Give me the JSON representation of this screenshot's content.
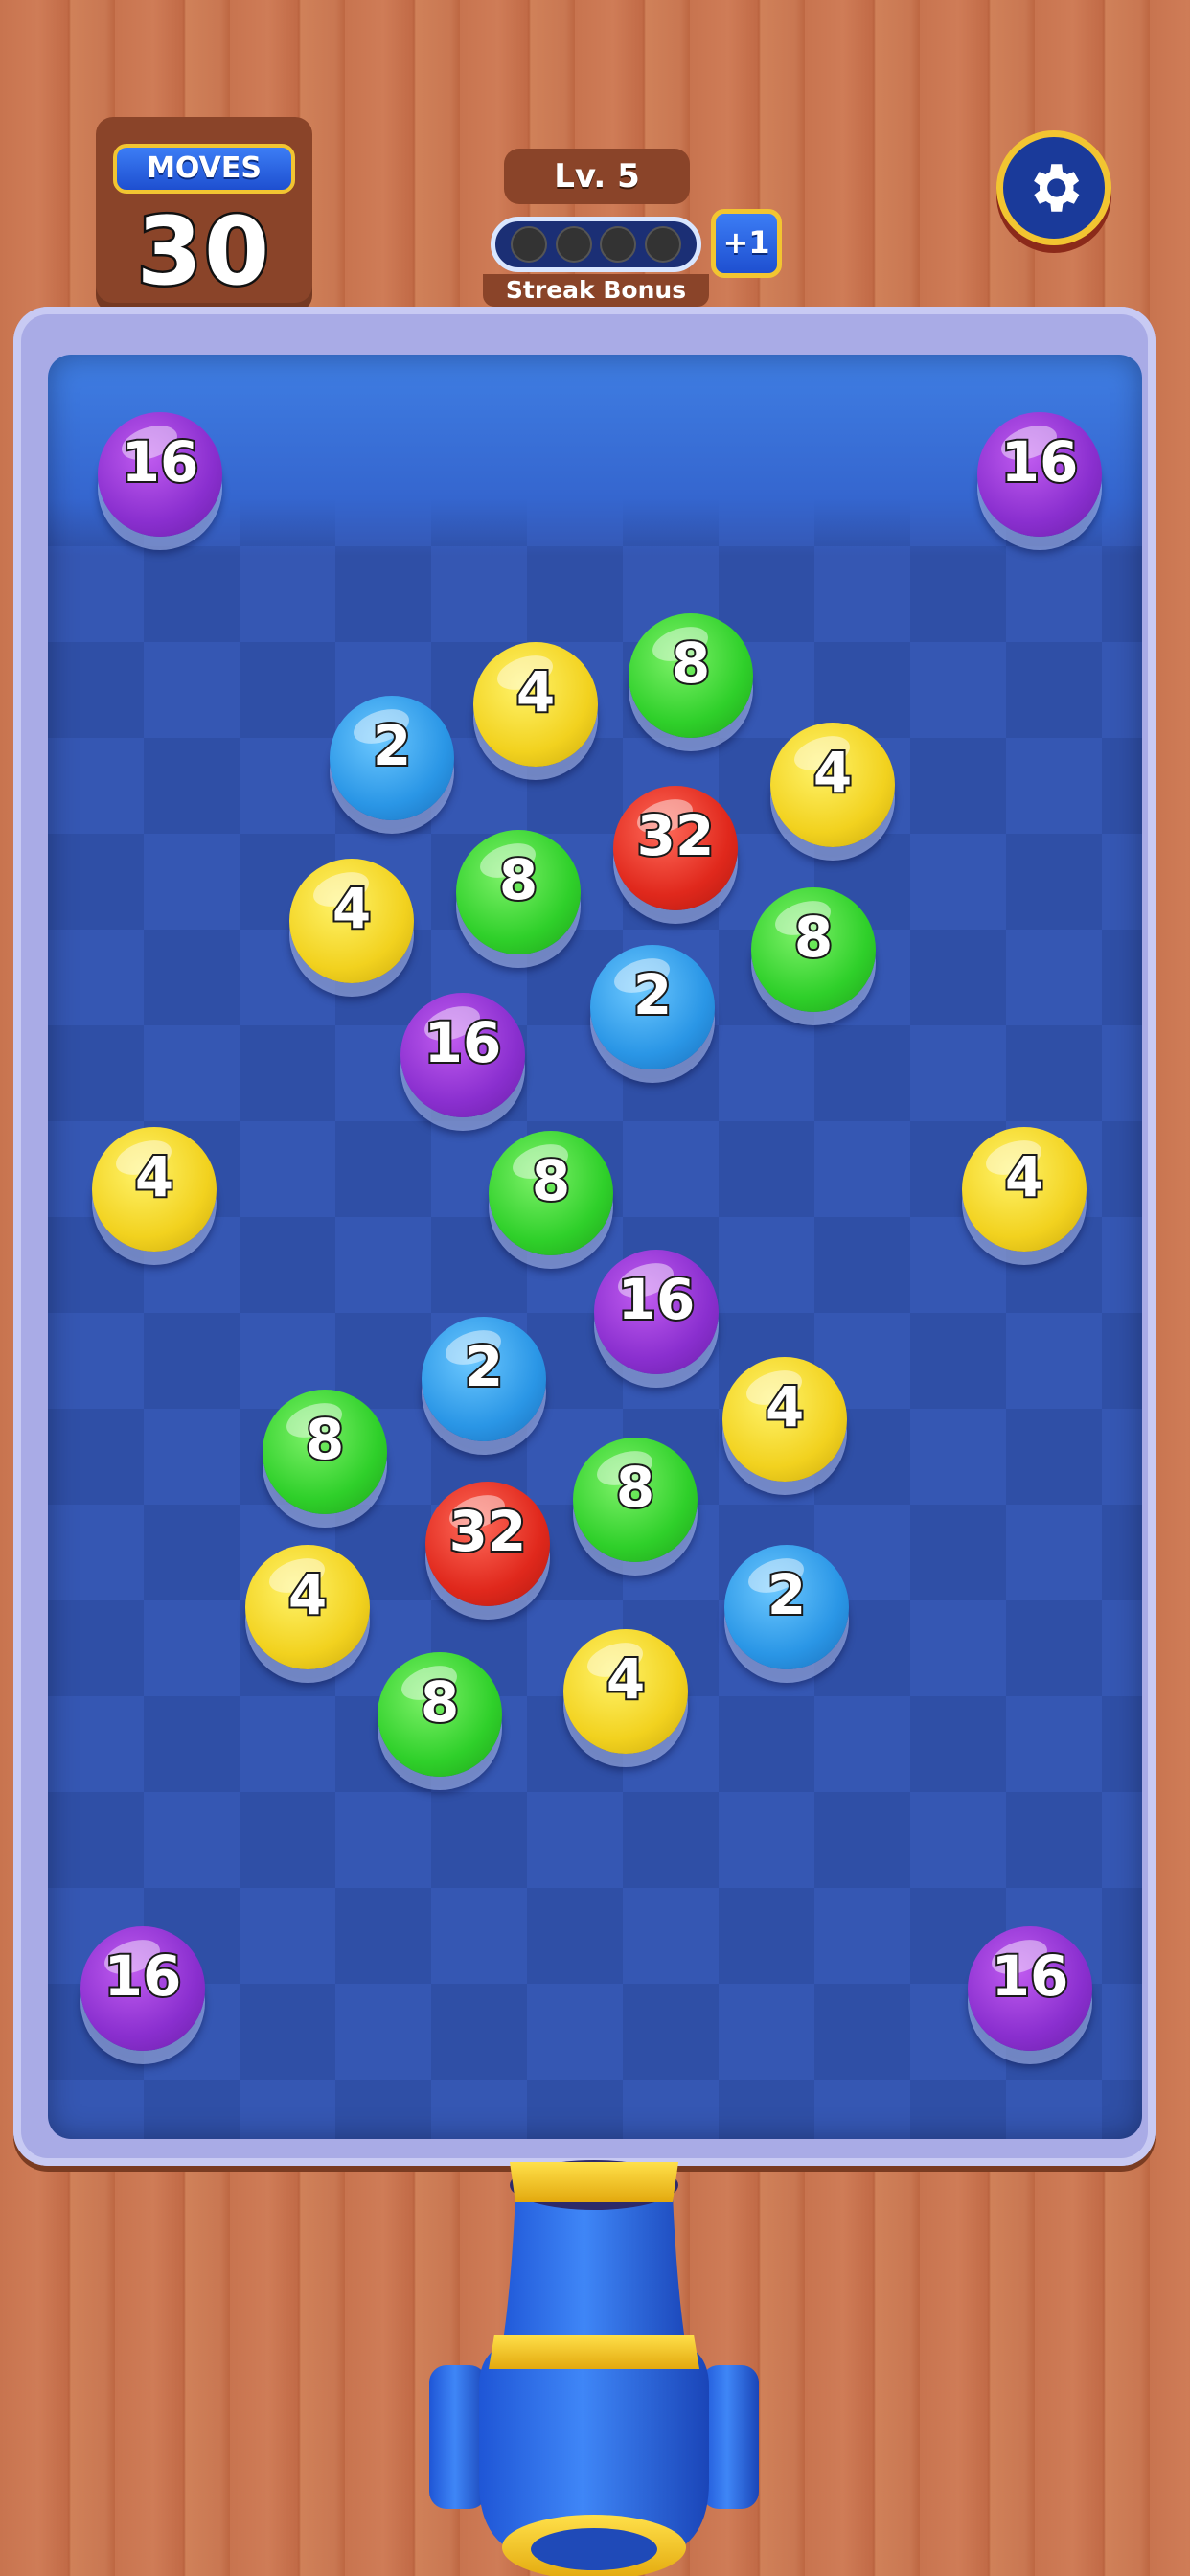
{
  "hud": {
    "moves_label": "MOVES",
    "moves_value": "30",
    "level_label": "Lv. 5",
    "streak_label": "Streak Bonus",
    "streak_bonus": "+1",
    "streak_filled": 0,
    "streak_total": 4
  },
  "icons": {
    "settings": "gear-icon"
  },
  "board": {
    "balls": [
      {
        "value": "16",
        "color": "purple"
      },
      {
        "value": "16",
        "color": "purple"
      },
      {
        "value": "8",
        "color": "green"
      },
      {
        "value": "4",
        "color": "yellow"
      },
      {
        "value": "2",
        "color": "blue"
      },
      {
        "value": "4",
        "color": "yellow"
      },
      {
        "value": "32",
        "color": "red"
      },
      {
        "value": "8",
        "color": "green"
      },
      {
        "value": "4",
        "color": "yellow"
      },
      {
        "value": "8",
        "color": "green"
      },
      {
        "value": "2",
        "color": "blue"
      },
      {
        "value": "16",
        "color": "purple"
      },
      {
        "value": "4",
        "color": "yellow"
      },
      {
        "value": "8",
        "color": "green"
      },
      {
        "value": "4",
        "color": "yellow"
      },
      {
        "value": "16",
        "color": "purple"
      },
      {
        "value": "2",
        "color": "blue"
      },
      {
        "value": "4",
        "color": "yellow"
      },
      {
        "value": "8",
        "color": "green"
      },
      {
        "value": "8",
        "color": "green"
      },
      {
        "value": "32",
        "color": "red"
      },
      {
        "value": "4",
        "color": "yellow"
      },
      {
        "value": "2",
        "color": "blue"
      },
      {
        "value": "8",
        "color": "green"
      },
      {
        "value": "4",
        "color": "yellow"
      },
      {
        "value": "16",
        "color": "purple"
      },
      {
        "value": "16",
        "color": "purple"
      }
    ]
  },
  "colors": {
    "hud_wood": "#8a4429",
    "hud_blue": "#1e4fd0",
    "gold": "#f2c531",
    "water": "#3557b3"
  }
}
